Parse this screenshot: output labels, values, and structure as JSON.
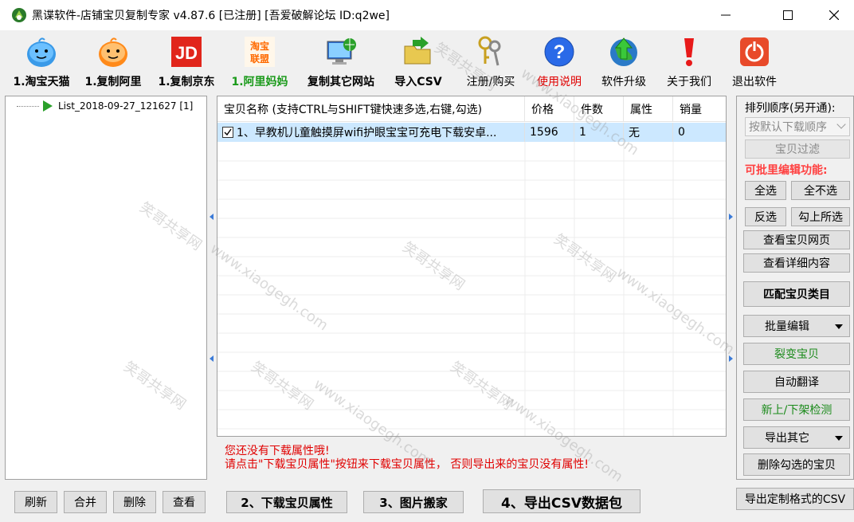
{
  "title": "黑谍软件-店铺宝贝复制专家  v4.87.6 [已注册] [吾爱破解论坛 ID:q2we]",
  "toolbar": {
    "items": [
      {
        "label": "1.淘宝天猫",
        "icon": "taobao-icon"
      },
      {
        "label": "1.复制阿里",
        "icon": "alibaba-icon"
      },
      {
        "label": "1.复制京东",
        "icon": "jd-icon"
      },
      {
        "label": "1.阿里妈妈",
        "icon": "alimama-icon",
        "color": "#1a9a1a"
      },
      {
        "label": "复制其它网站",
        "icon": "globe-monitor-icon"
      },
      {
        "label": "导入CSV",
        "icon": "folder-arrow-icon"
      },
      {
        "label": "注册/购买",
        "icon": "keys-icon"
      },
      {
        "label": "使用说明",
        "icon": "help-icon",
        "color": "#e00000"
      },
      {
        "label": "软件升级",
        "icon": "upgrade-globe-icon"
      },
      {
        "label": "关于我们",
        "icon": "exclamation-icon"
      },
      {
        "label": "退出软件",
        "icon": "power-icon"
      }
    ],
    "jd_text": "JD",
    "alimama_text_top": "淘宝",
    "alimama_text_bottom": "联盟"
  },
  "tree": {
    "items": [
      {
        "label": "List_2018-09-27_121627 [1]"
      }
    ]
  },
  "grid": {
    "columns": [
      "宝贝名称  (支持CTRL与SHIFT键快速多选,右键,勾选)",
      "价格",
      "件数",
      "属性",
      "销量"
    ],
    "rows": [
      {
        "name": "1、早教机儿童触摸屏wifi护眼宝宝可充电下载安卓...",
        "price": "1596",
        "qty": "1",
        "attr": "无",
        "sales": "0",
        "checked": true
      }
    ]
  },
  "message": {
    "line1": "您还没有下载属性哦!",
    "line2": "请点击\"下载宝贝属性\"按钮来下载宝贝属性，  否则导出来的宝贝没有属性!"
  },
  "right_panel": {
    "sort_title": "排列顺序(另开通):",
    "sort_value": "按默认下载顺序",
    "filter_button": "宝贝过滤",
    "batch_title": "可批里编辑功能:",
    "select_all": "全选",
    "select_none": "全不选",
    "invert": "反选",
    "check_selected": "勾上所选",
    "view_page": "查看宝贝网页",
    "view_detail": "查看详细内容",
    "match_category": "匹配宝贝类目",
    "batch_edit": "批量编辑",
    "split_item": "裂变宝贝",
    "auto_translate": "自动翻译",
    "shelf_check": "新上/下架检测",
    "export_other": "导出其它",
    "delete_checked": "删除勾选的宝贝"
  },
  "bottom": {
    "refresh": "刷新",
    "merge": "合并",
    "delete": "删除",
    "view": "查看",
    "download_attr": "2、下载宝贝属性",
    "image_move": "3、图片搬家",
    "export_csv": "4、导出CSV数据包",
    "export_custom": "导出定制格式的CSV"
  },
  "watermarks": [
    "笑哥共享网",
    "www.xiaogegh.com"
  ]
}
